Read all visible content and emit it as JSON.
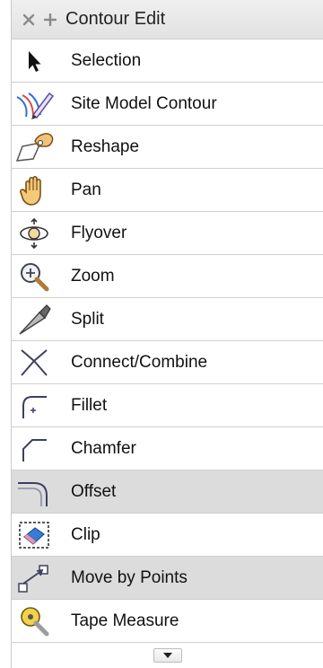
{
  "palette": {
    "title": "Contour Edit",
    "items": [
      {
        "label": "Selection",
        "icon": "arrow-cursor-icon",
        "highlighted": true
      },
      {
        "label": "Site Model Contour",
        "icon": "contour-pencil-icon",
        "highlighted": false
      },
      {
        "label": "Reshape",
        "icon": "reshape-hand-icon",
        "highlighted": false
      },
      {
        "label": "Pan",
        "icon": "pan-hand-icon",
        "highlighted": false
      },
      {
        "label": "Flyover",
        "icon": "flyover-orbit-icon",
        "highlighted": false
      },
      {
        "label": "Zoom",
        "icon": "zoom-magnifier-icon",
        "highlighted": false
      },
      {
        "label": "Split",
        "icon": "split-knife-icon",
        "highlighted": false
      },
      {
        "label": "Connect/Combine",
        "icon": "connect-combine-icon",
        "highlighted": false
      },
      {
        "label": "Fillet",
        "icon": "fillet-icon",
        "highlighted": false
      },
      {
        "label": "Chamfer",
        "icon": "chamfer-icon",
        "highlighted": false
      },
      {
        "label": "Offset",
        "icon": "offset-icon",
        "highlighted": true
      },
      {
        "label": "Clip",
        "icon": "clip-eraser-icon",
        "highlighted": false
      },
      {
        "label": "Move by Points",
        "icon": "move-by-points-icon",
        "highlighted": true
      },
      {
        "label": "Tape Measure",
        "icon": "tape-measure-icon",
        "highlighted": false
      }
    ]
  },
  "colors": {
    "selected_row": "#dcdcdc",
    "row_border": "#cfcfcf",
    "title_bar": "#e6e6e6"
  }
}
